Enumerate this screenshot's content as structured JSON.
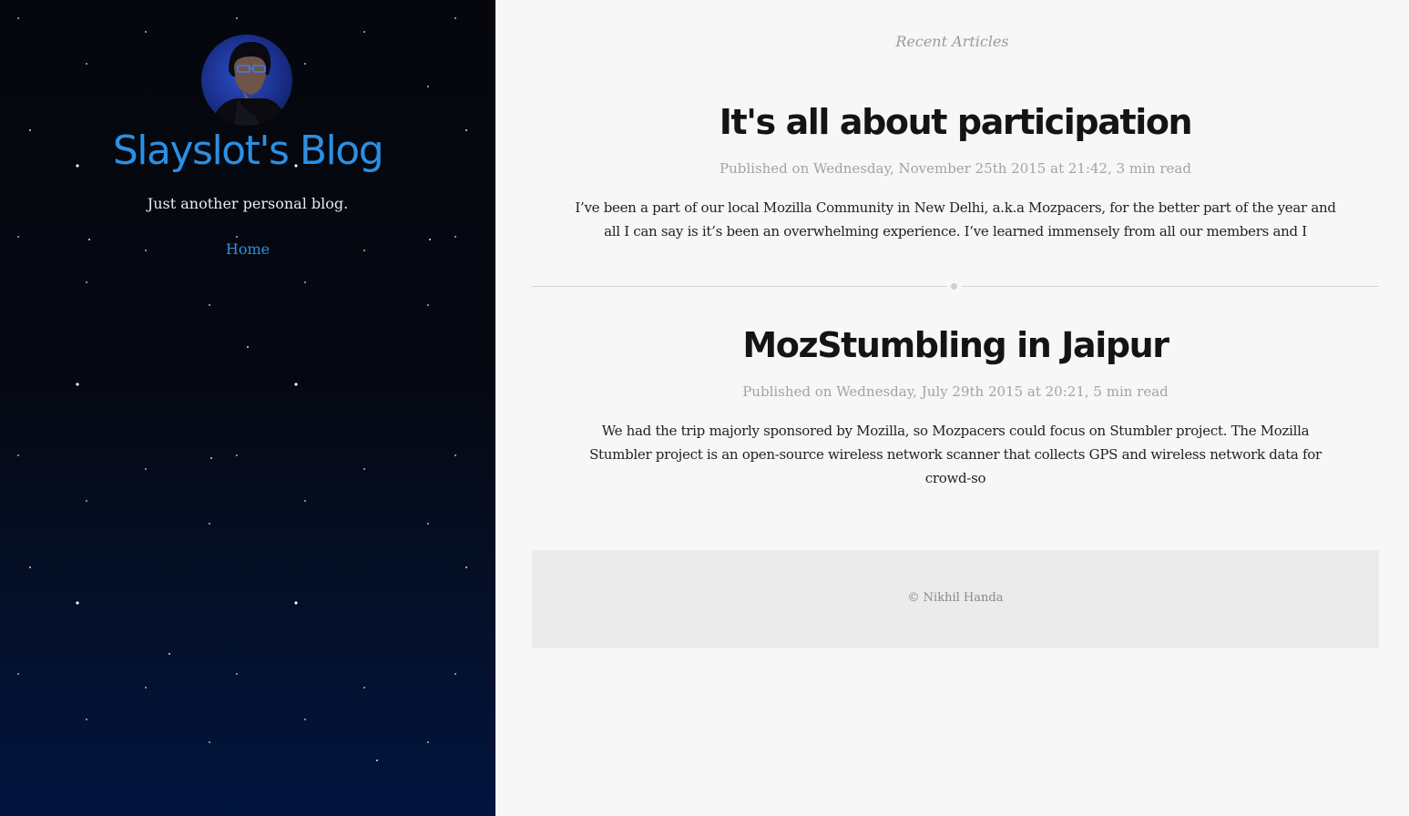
{
  "sidebar": {
    "avatar_alt": "Slayslot avatar",
    "blog_title": "Slayslot's Blog",
    "tagline": "Just another personal blog.",
    "nav": [
      {
        "label": "Home"
      }
    ]
  },
  "main": {
    "section_label": "Recent Articles",
    "articles": [
      {
        "title": "It's all about participation",
        "meta": "Published on Wednesday, November 25th 2015 at 21:42, 3 min read",
        "excerpt": "I’ve been a part of our local Mozilla Community in New Delhi, a.k.a Mozpacers, for the better part of the year and all I can say is it’s been an overwhelming experience. I’ve learned immensely from all our members and I"
      },
      {
        "title": "MozStumbling in Jaipur",
        "meta": "Published on Wednesday, July 29th 2015 at 20:21, 5 min read",
        "excerpt": "We had the trip majorly sponsored by Mozilla, so Mozpacers could focus on Stumbler project. The Mozilla Stumbler project is an open-source wireless network scanner that collects GPS and wireless network data for crowd-so"
      }
    ],
    "footer": "© Nikhil Handa"
  },
  "colors": {
    "accent": "#2c8fe3",
    "sidebar_top": "#05070d",
    "sidebar_bottom": "#021540",
    "main_bg": "#f7f7f7",
    "footer_bg": "#ebebeb"
  }
}
